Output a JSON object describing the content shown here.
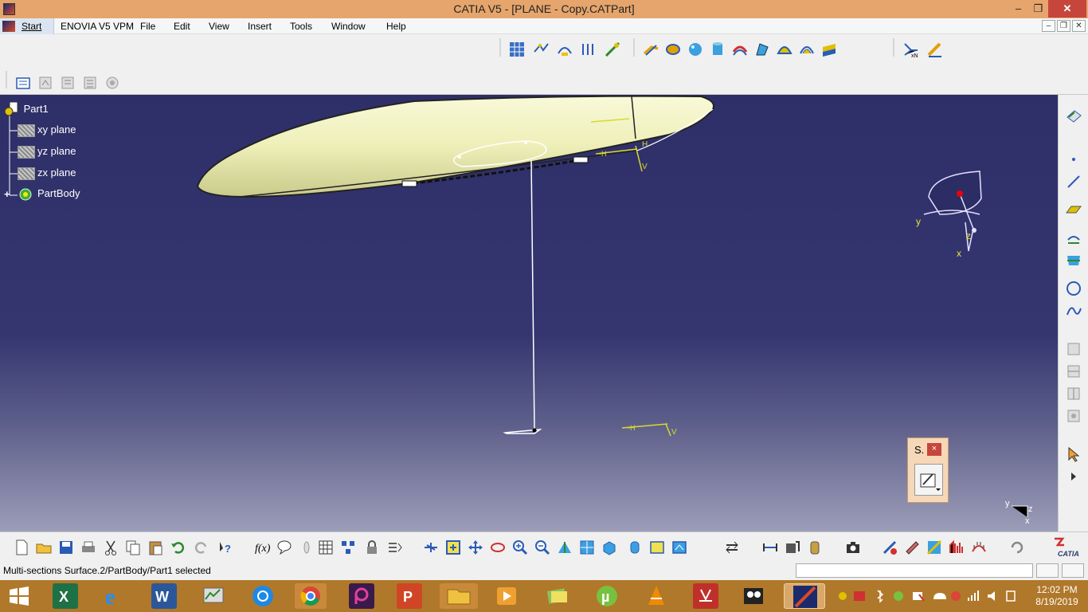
{
  "window": {
    "title": "CATIA V5 - [PLANE - Copy.CATPart]",
    "minimize": "–",
    "restore": "❐",
    "close": "✕"
  },
  "menubar": {
    "start": "Start",
    "items": [
      "ENOVIA V5 VPM",
      "File",
      "Edit",
      "View",
      "Insert",
      "Tools",
      "Window",
      "Help"
    ]
  },
  "tree": {
    "root": "Part1",
    "items": [
      {
        "label": "xy plane",
        "icon": "plane-icon"
      },
      {
        "label": "yz plane",
        "icon": "plane-icon"
      },
      {
        "label": "zx plane",
        "icon": "plane-icon"
      },
      {
        "label": "PartBody",
        "icon": "partbody-icon"
      }
    ]
  },
  "viewport": {
    "compass_labels": {
      "y": "y",
      "z": "z",
      "x": "x"
    },
    "axis_labels": {
      "y": "y",
      "z": "z",
      "x": "x"
    },
    "constraint_labels": {
      "h": "H",
      "v": "V"
    }
  },
  "float_panel": {
    "title": "S.",
    "close": "×"
  },
  "status": {
    "message": "Multi-sections Surface.2/PartBody/Part1 selected",
    "command_value": ""
  },
  "taskbar": {
    "time": "12:02 PM",
    "date": "8/19/2019",
    "apps": [
      "windows-start",
      "excel",
      "internet-explorer",
      "word",
      "task-manager",
      "sync-app",
      "chrome",
      "picsart",
      "powerpoint",
      "file-explorer",
      "media-player",
      "photos",
      "utorrent",
      "vlc",
      "acrobat",
      "camera-app",
      "catia"
    ]
  },
  "colors": {
    "titlebar": "#e6a56c",
    "taskbar": "#b0782a",
    "viewport_top": "#2e2f68",
    "viewport_bottom": "#9c9db8",
    "fuselage": "#f1f2c0",
    "constraint": "#d8d830"
  },
  "brand": {
    "logo": "CATIA"
  }
}
